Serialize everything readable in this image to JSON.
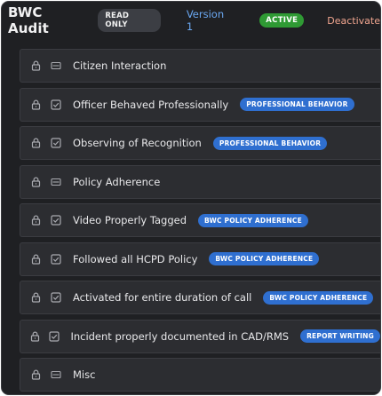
{
  "header": {
    "title": "BWC Audit",
    "read_only_badge": "READ ONLY",
    "version": "Version 1",
    "status_badge": "ACTIVE",
    "deactivate_label": "Deactivate"
  },
  "items": [
    {
      "label": "Citizen Interaction",
      "icon": "section-icon",
      "tag": ""
    },
    {
      "label": "Officer Behaved Professionally",
      "icon": "checkbox-icon",
      "tag": "PROFESSIONAL BEHAVIOR"
    },
    {
      "label": "Observing of Recognition",
      "icon": "checkbox-icon",
      "tag": "PROFESSIONAL BEHAVIOR"
    },
    {
      "label": "Policy Adherence",
      "icon": "section-icon",
      "tag": ""
    },
    {
      "label": "Video Properly Tagged",
      "icon": "checkbox-icon",
      "tag": "BWC POLICY ADHERENCE"
    },
    {
      "label": "Followed all HCPD Policy",
      "icon": "checkbox-icon",
      "tag": "BWC POLICY ADHERENCE"
    },
    {
      "label": "Activated for entire duration of call",
      "icon": "checkbox-icon",
      "tag": "BWC POLICY ADHERENCE"
    },
    {
      "label": "Incident properly documented in CAD/RMS",
      "icon": "checkbox-icon",
      "tag": "REPORT WRITING"
    },
    {
      "label": "Misc",
      "icon": "section-icon",
      "tag": ""
    }
  ],
  "colors": {
    "background": "#1f2023",
    "row": "#2c2d31",
    "tag": "#2f6fd0",
    "active": "#2f9a34",
    "version_link": "#6aa8f2",
    "deactivate": "#f0a58f"
  }
}
